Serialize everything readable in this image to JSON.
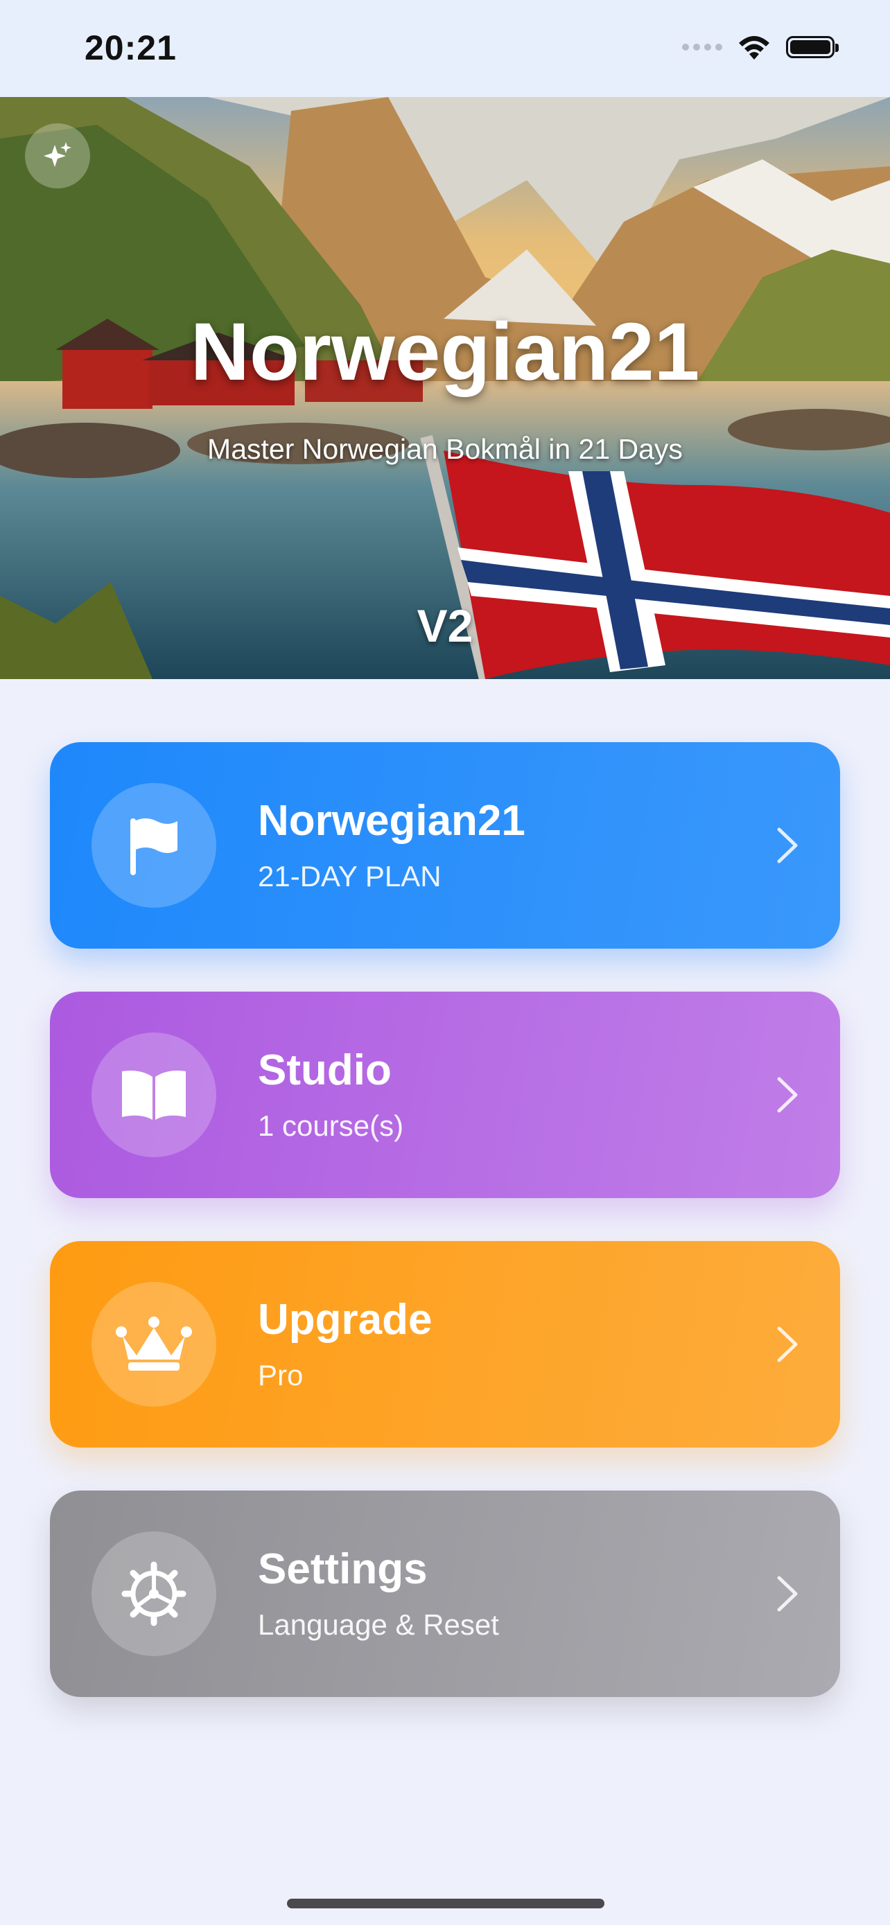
{
  "status_bar": {
    "time": "20:21"
  },
  "hero": {
    "title": "Norwegian21",
    "subtitle": "Master Norwegian Bokmål in 21 Days",
    "version": "V2",
    "sparkle_icon": "sparkles-icon"
  },
  "menu": [
    {
      "title": "Norwegian21",
      "subtitle": "21-DAY PLAN",
      "icon": "flag-icon",
      "color": "#1e88fb"
    },
    {
      "title": "Studio",
      "subtitle": "1 course(s)",
      "icon": "book-icon",
      "color": "#ac5ae0"
    },
    {
      "title": "Upgrade",
      "subtitle": "Pro",
      "icon": "crown-icon",
      "color": "#fe9b12"
    },
    {
      "title": "Settings",
      "subtitle": "Language & Reset",
      "icon": "gear-icon",
      "color": "#8f8f94"
    }
  ]
}
